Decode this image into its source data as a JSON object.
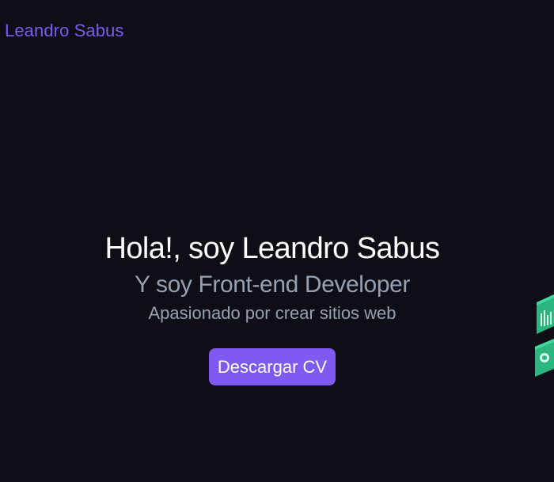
{
  "header": {
    "brand": "Leandro Sabus"
  },
  "hero": {
    "title": "Hola!, soy Leandro Sabus",
    "subtitle": "Y soy Front-end Developer",
    "tagline": "Apasionado por crear sitios web",
    "cv_button_label": "Descargar CV"
  },
  "colors": {
    "background": "#0f0e17",
    "accent": "#7f5af0",
    "heading": "#fffffe",
    "muted": "#94a1b2",
    "decoration": "#2cb67d"
  },
  "icons": [
    "chart-icon",
    "code-icon"
  ]
}
